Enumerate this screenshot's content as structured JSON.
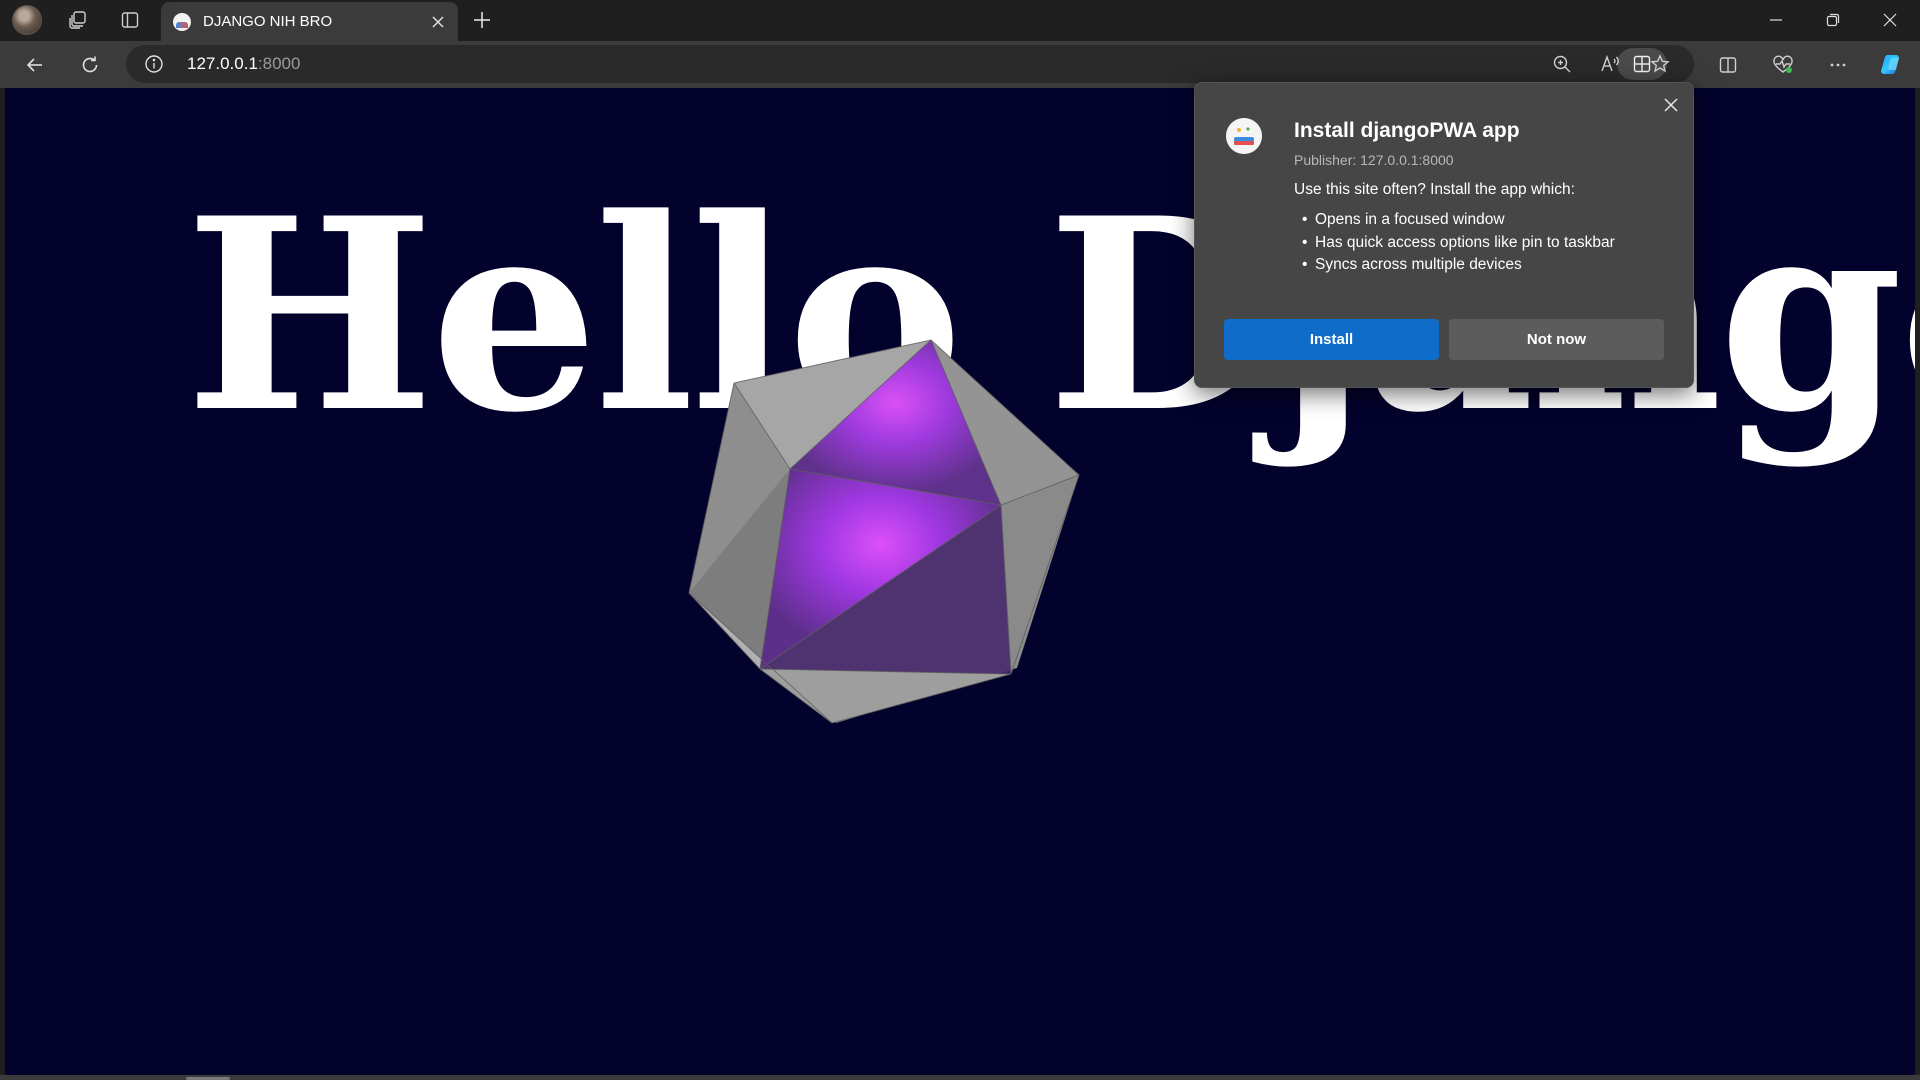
{
  "browser": {
    "tab": {
      "title": "DJANGO NIH BRO"
    },
    "address_bar": {
      "host": "127.0.0.1",
      "port": ":8000"
    }
  },
  "page": {
    "heading": "Hello Django",
    "background_color": "#03022c"
  },
  "install_popup": {
    "title": "Install djangoPWA app",
    "publisher": "Publisher: 127.0.0.1:8000",
    "description": "Use this site often? Install the app which:",
    "features": [
      "Opens in a focused window",
      "Has quick access options like pin to taskbar",
      "Syncs across multiple devices"
    ],
    "install_label": "Install",
    "not_now_label": "Not now",
    "accent_color": "#0f6cc8"
  },
  "icons": [
    "profile-avatar",
    "workspaces-icon",
    "tab-actions-icon",
    "tab-favicon",
    "close-tab-icon",
    "new-tab-icon",
    "minimize-icon",
    "restore-icon",
    "close-window-icon",
    "back-icon",
    "refresh-icon",
    "site-info-icon",
    "app-available-icon",
    "zoom-icon",
    "read-aloud-icon",
    "favorite-icon",
    "split-screen-icon",
    "browser-essentials-icon",
    "more-icon",
    "copilot-icon"
  ]
}
